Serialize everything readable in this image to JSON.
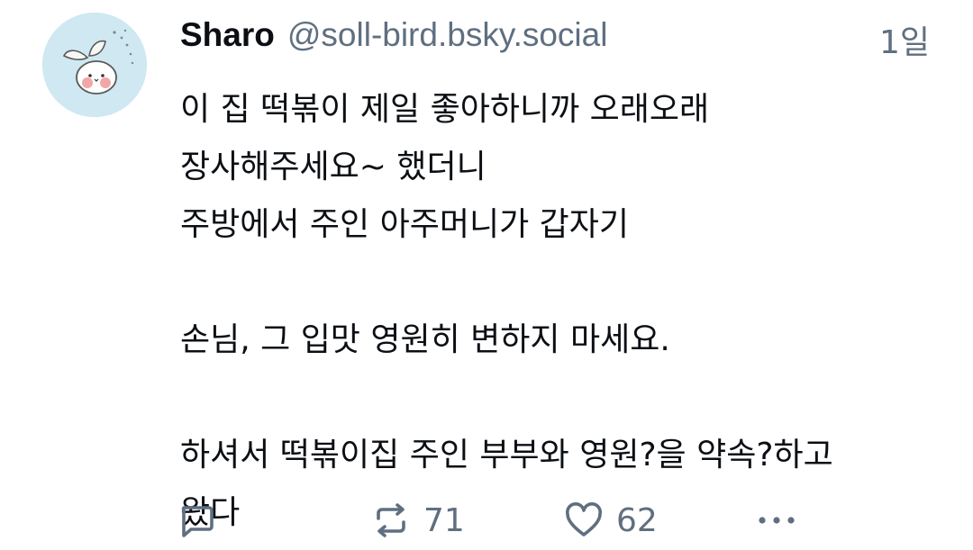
{
  "post": {
    "author": {
      "display_name": "Sharo",
      "handle": "@soll-bird.bsky.social",
      "avatar_icon": "bird-peach-avatar"
    },
    "timestamp": "1일",
    "text": "이 집 떡볶이 제일 좋아하니까 오래오래\n장사해주세요~ 했더니\n주방에서 주인 아주머니가 갑자기\n\n손님, 그 입맛 영원히 변하지 마세요.\n\n하셔서 떡볶이집 주인 부부와 영원?을 약속?하고\n왔다",
    "actions": {
      "reply": {
        "icon": "reply-icon",
        "count": ""
      },
      "repost": {
        "icon": "repost-icon",
        "count": "71"
      },
      "like": {
        "icon": "heart-icon",
        "count": "62"
      },
      "more": {
        "icon": "more-icon"
      }
    }
  },
  "colors": {
    "text": "#0b0f14",
    "secondary": "#5f6f80",
    "avatar_bg": "#cfe8f2"
  }
}
